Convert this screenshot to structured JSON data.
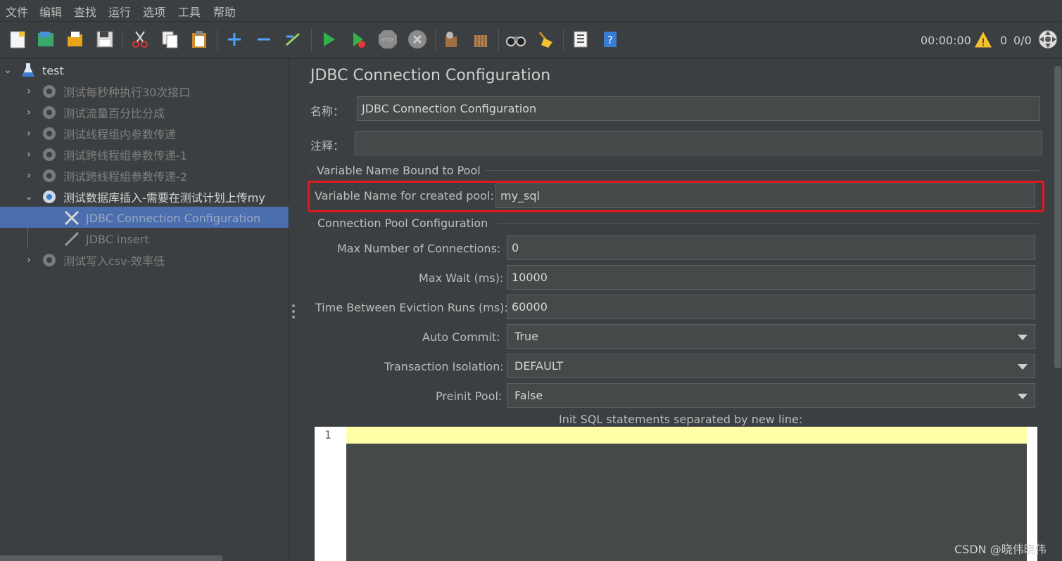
{
  "menu": [
    "文件",
    "编辑",
    "查找",
    "运行",
    "选项",
    "工具",
    "帮助"
  ],
  "toolbar": {
    "icons": [
      "new-icon",
      "templates-icon",
      "open-icon",
      "save-icon",
      "cut-icon",
      "copy-icon",
      "paste-icon",
      "expand-icon",
      "collapse-icon",
      "toggle-icon",
      "start-icon",
      "start-no-pause-icon",
      "stop-icon",
      "shutdown-icon",
      "clear-icon",
      "clear-all-icon",
      "search-icon",
      "reset-search-icon",
      "function-helper-icon",
      "help-icon"
    ],
    "timer": "00:00:00",
    "warn_count": "0",
    "threads": "0/0"
  },
  "tree": {
    "root": "test",
    "groups": [
      "测试每秒种执行30次接口",
      "测试流量百分比分成",
      "测试线程组内参数传递",
      "测试跨线程组参数传递-1",
      "测试跨线程组参数传递-2",
      "测试数据库插入-需要在测试计划上传my"
    ],
    "children": [
      "JDBC Connection Configuration",
      "JDBC insert"
    ],
    "last_group": "测试写入csv-效率低"
  },
  "panel": {
    "title": "JDBC Connection Configuration",
    "name_label": "名称：",
    "name_value": "JDBC Connection Configuration",
    "comment_label": "注释：",
    "comment_value": "",
    "section_pool_var": "Variable Name Bound to Pool",
    "pool_var_label": "Variable Name for created pool:",
    "pool_var_value": "my_sql",
    "section_pool_cfg": "Connection Pool Configuration",
    "max_conn_label": "Max Number of Connections:",
    "max_conn_value": "0",
    "max_wait_label": "Max Wait (ms):",
    "max_wait_value": "10000",
    "eviction_label": "Time Between Eviction Runs (ms):",
    "eviction_value": "60000",
    "auto_commit_label": "Auto Commit:",
    "auto_commit_value": "True",
    "isolation_label": "Transaction Isolation:",
    "isolation_value": "DEFAULT",
    "preinit_label": "Preinit Pool:",
    "preinit_value": "False",
    "init_sql_label": "Init SQL statements separated by new line:",
    "editor_line": "1"
  },
  "watermark": "CSDN @晓伟晓伟"
}
